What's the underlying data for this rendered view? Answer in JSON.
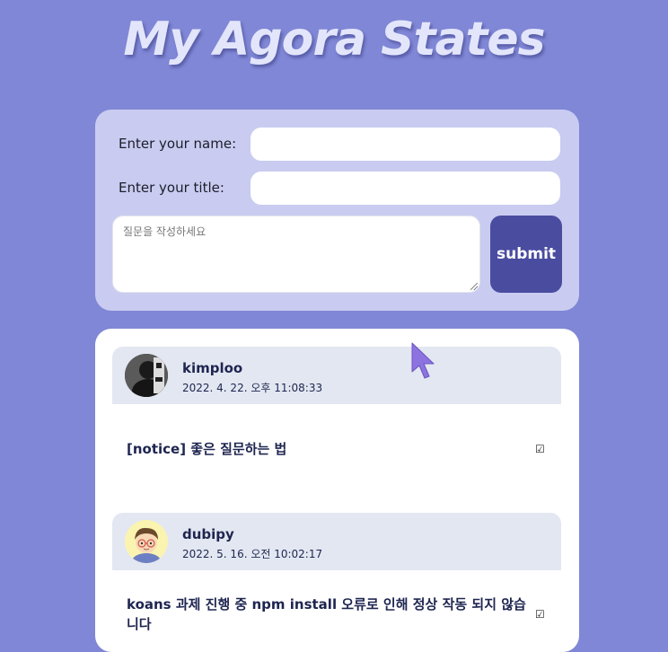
{
  "header": {
    "title": "My Agora States"
  },
  "form": {
    "name_label": "Enter your name:",
    "name_value": "",
    "title_label": "Enter your title:",
    "title_value": "",
    "question_placeholder": "질문을  작성하세요",
    "submit_label": "submit"
  },
  "discussions": [
    {
      "author": "kimploo",
      "date": "2022. 4. 22. 오후 11:08:33",
      "title": "[notice] 좋은 질문하는 법",
      "answered_icon": "☑"
    },
    {
      "author": "dubipy",
      "date": "2022. 5. 16. 오전 10:02:17",
      "title": "koans 과제 진행 중 npm install 오류로 인해 정상 작동 되지 않습니다",
      "answered_icon": "☑"
    }
  ],
  "colors": {
    "background": "#8087d6",
    "form_card": "#c9ccf0",
    "submit": "#4a4ca0",
    "post_header": "#e3e7f1",
    "text": "#1e2550"
  }
}
